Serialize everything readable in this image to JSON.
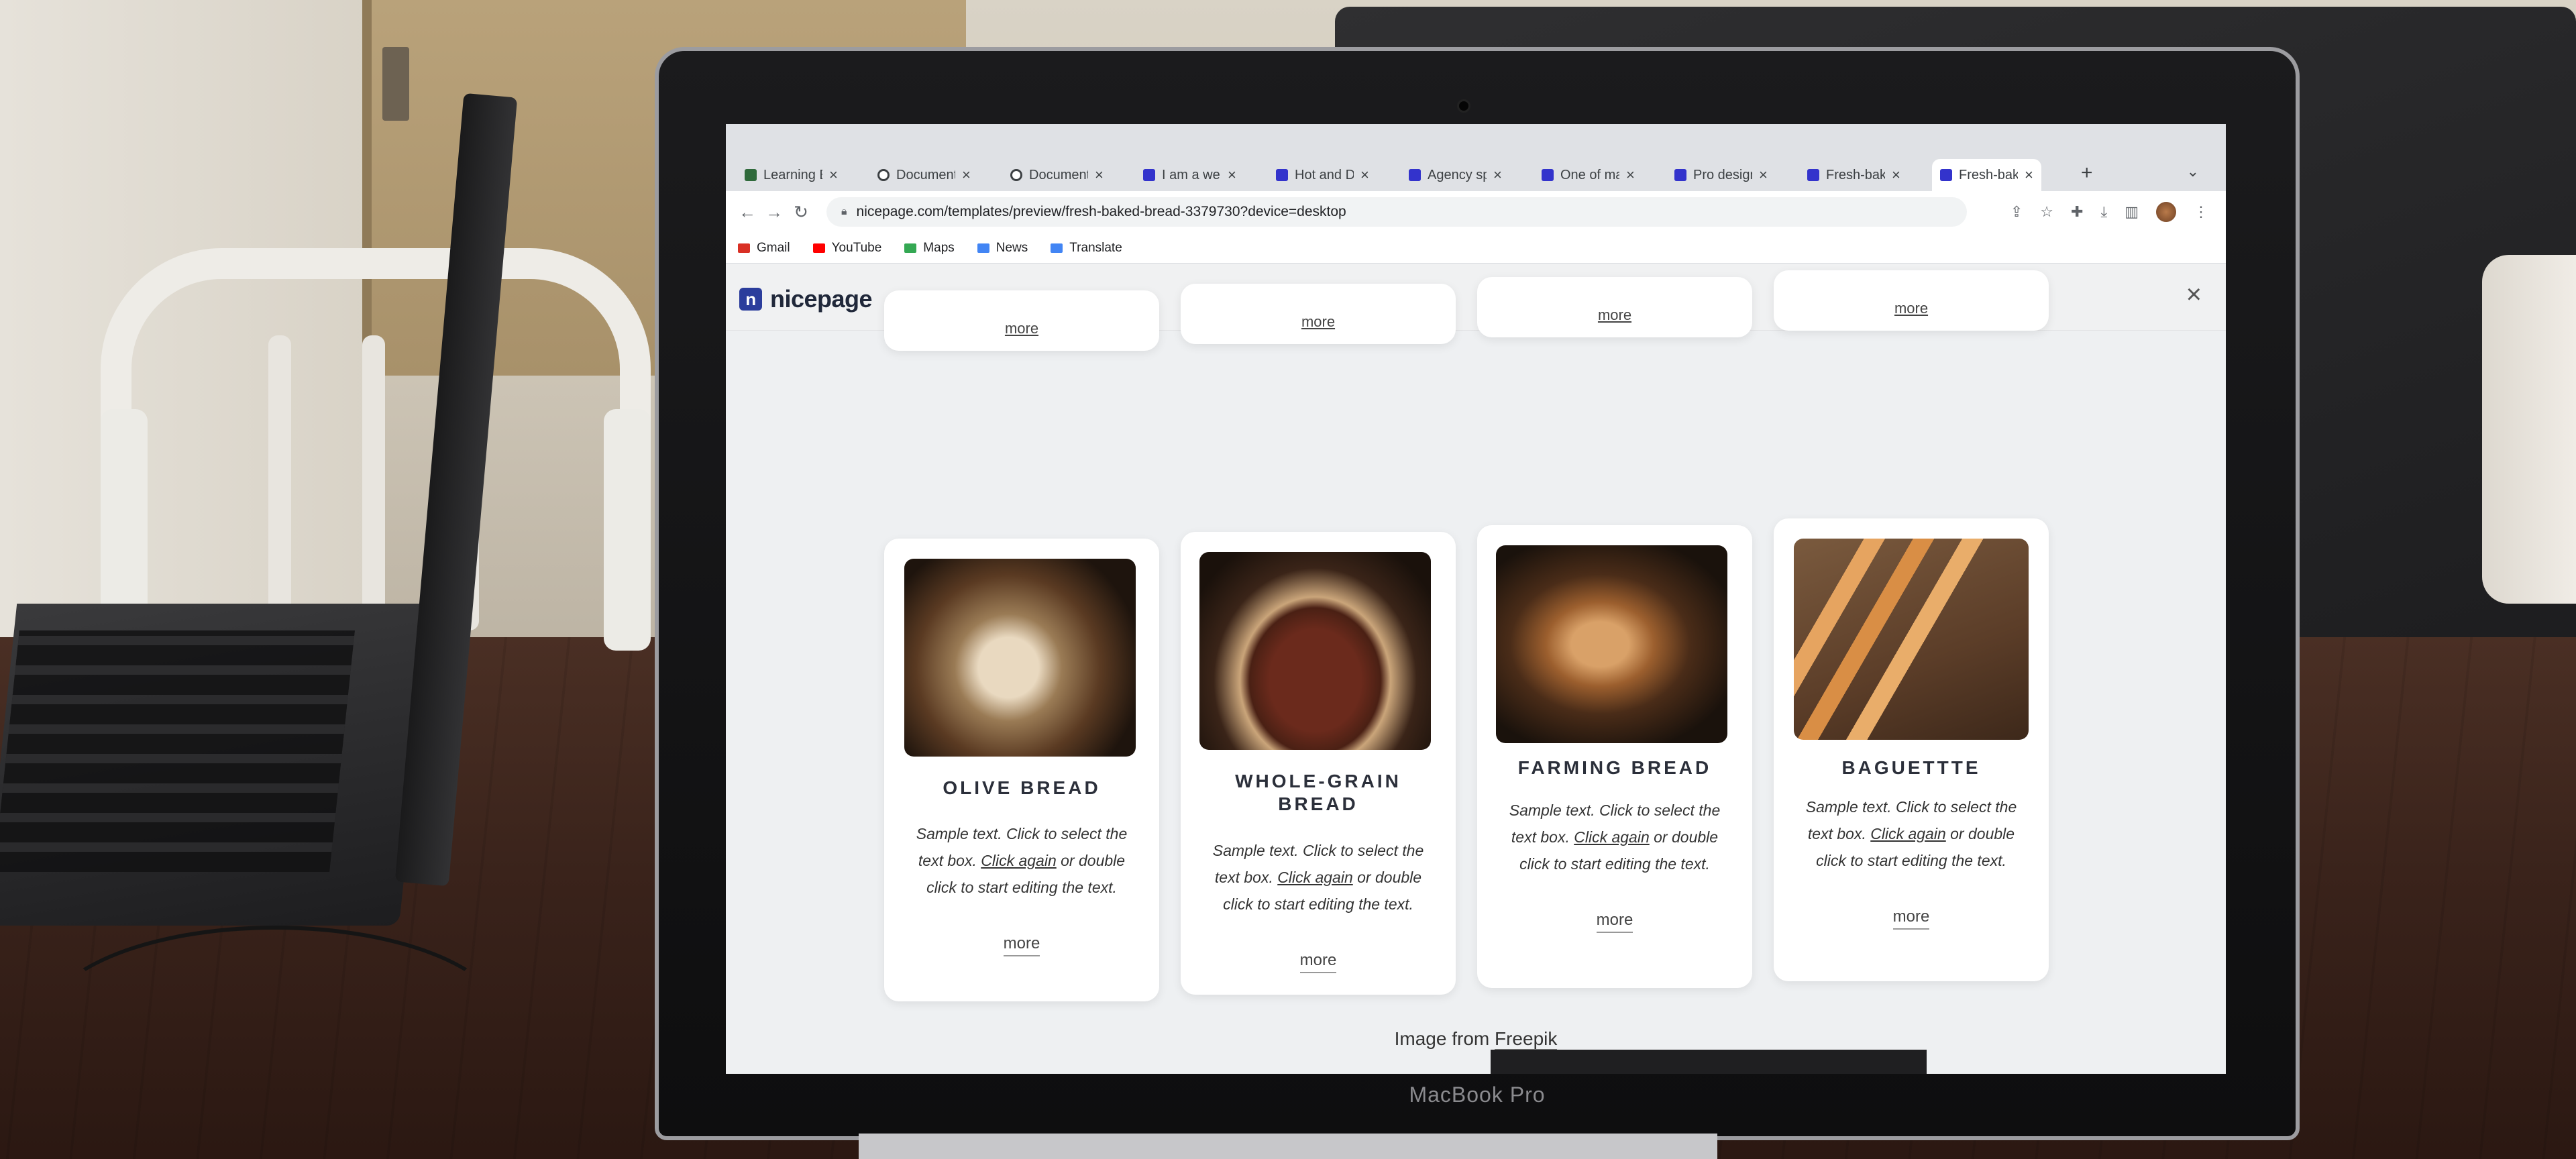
{
  "device_label": "MacBook Pro",
  "browser": {
    "tabs": [
      {
        "title": "Learning Ba",
        "icon": "learning-icon",
        "active": false
      },
      {
        "title": "Document",
        "icon": "globe-icon",
        "active": false
      },
      {
        "title": "Document",
        "icon": "globe-icon",
        "active": false
      },
      {
        "title": "I am a web",
        "icon": "nicepage-icon",
        "active": false
      },
      {
        "title": "Hot and De",
        "icon": "nicepage-icon",
        "active": false
      },
      {
        "title": "Agency spe",
        "icon": "nicepage-icon",
        "active": false
      },
      {
        "title": "One of mar",
        "icon": "nicepage-icon",
        "active": false
      },
      {
        "title": "Pro design",
        "icon": "nicepage-icon",
        "active": false
      },
      {
        "title": "Fresh-bake",
        "icon": "nicepage-icon",
        "active": false
      },
      {
        "title": "Fresh-bake",
        "icon": "nicepage-icon",
        "active": true
      }
    ],
    "close_glyph": "×",
    "new_tab_glyph": "+",
    "url": "nicepage.com/templates/preview/fresh-baked-bread-3379730?device=desktop",
    "bookmarks": [
      {
        "label": "Gmail",
        "color": "#d93025"
      },
      {
        "label": "YouTube",
        "color": "#ff0000"
      },
      {
        "label": "Maps",
        "color": "#34a853"
      },
      {
        "label": "News",
        "color": "#4285f4"
      },
      {
        "label": "Translate",
        "color": "#4285f4"
      }
    ]
  },
  "nicepage": {
    "logo_text": "nicepage",
    "logo_mark": "n",
    "close_glyph": "×",
    "devices": [
      "desktop",
      "laptop",
      "tablet",
      "tablet-landscape",
      "phone"
    ],
    "top_more_labels": [
      "more",
      "more",
      "more",
      "more"
    ],
    "cards": [
      {
        "title": "OLIVE BREAD",
        "text_before": "Sample text. Click to select the text box. ",
        "link": "Click again",
        "text_after": " or double click to start editing the text.",
        "more": "more",
        "photo": "olive-bread-photo"
      },
      {
        "title": "WHOLE-GRAIN BREAD",
        "text_before": "Sample text. Click to select the text box. ",
        "link": "Click again",
        "text_after": " or double click to start editing the text.",
        "more": "more",
        "photo": "whole-grain-bread-photo"
      },
      {
        "title": "FARMING BREAD",
        "text_before": "Sample text. Click to select the text box. ",
        "link": "Click again",
        "text_after": " or double click to start editing the text.",
        "more": "more",
        "photo": "farming-bread-photo"
      },
      {
        "title": "BAGUETTTE",
        "text_before": "Sample text. Click to select the text box. ",
        "link": "Click again",
        "text_after": " or double click to start editing the text.",
        "more": "more",
        "photo": "baguette-photo"
      }
    ],
    "credit_prefix": "Image from ",
    "credit_link": "Freepik"
  }
}
